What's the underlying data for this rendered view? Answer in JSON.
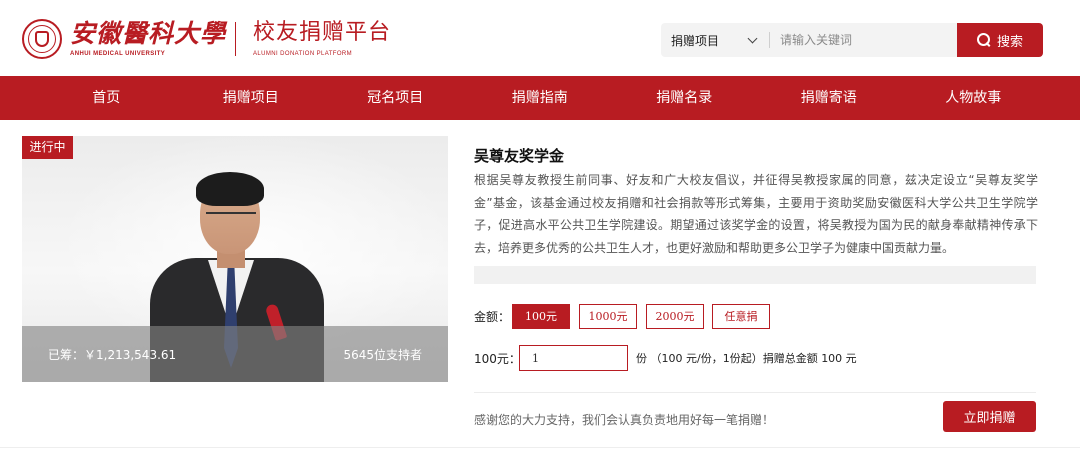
{
  "header": {
    "university_name": "安徽醫科大學",
    "university_name_en": "ANHUI MEDICAL UNIVERSITY",
    "platform_name": "校友捐赠平台",
    "platform_name_en": "ALUMNI DONATION PLATFORM"
  },
  "search": {
    "category": "捐赠项目",
    "placeholder": "请输入关键词",
    "button_label": "搜索"
  },
  "nav": {
    "items": [
      {
        "label": "首页"
      },
      {
        "label": "捐赠项目"
      },
      {
        "label": "冠名项目"
      },
      {
        "label": "捐赠指南"
      },
      {
        "label": "捐赠名录"
      },
      {
        "label": "捐赠寄语"
      },
      {
        "label": "人物故事"
      }
    ]
  },
  "project": {
    "status": "进行中",
    "raised": "已筹：￥1,213,543.61",
    "supporters": "5645位支持者",
    "title": "吴尊友奖学金",
    "description": "根据吴尊友教授生前同事、好友和广大校友倡议，并征得吴教授家属的同意，兹决定设立“吴尊友奖学金”基金，该基金通过校友捐赠和社会捐款等形式筹集，主要用于资助奖励安徽医科大学公共卫生学院学子，促进高水平公共卫生学院建设。期望通过该奖学金的设置，将吴教授为国为民的献身奉献精神传承下去，培养更多优秀的公共卫生人才，也更好激励和帮助更多公卫学子为健康中国贡献力量。",
    "progress_fraction": 0
  },
  "donation": {
    "amount_label": "金额：",
    "amounts": [
      {
        "label": "100元",
        "selected": true
      },
      {
        "label": "1000元",
        "selected": false
      },
      {
        "label": "2000元",
        "selected": false
      },
      {
        "label": "任意捐",
        "selected": false
      }
    ],
    "qty_label": "100元：",
    "qty_value": "1",
    "qty_note": "份 （100 元/份，1份起）捐赠总金额 100 元",
    "thanks": "感谢您的大力支持，我们会认真负责地用好每一笔捐赠！",
    "donate_button": "立即捐赠"
  },
  "colors": {
    "brand": "#b81c22"
  }
}
